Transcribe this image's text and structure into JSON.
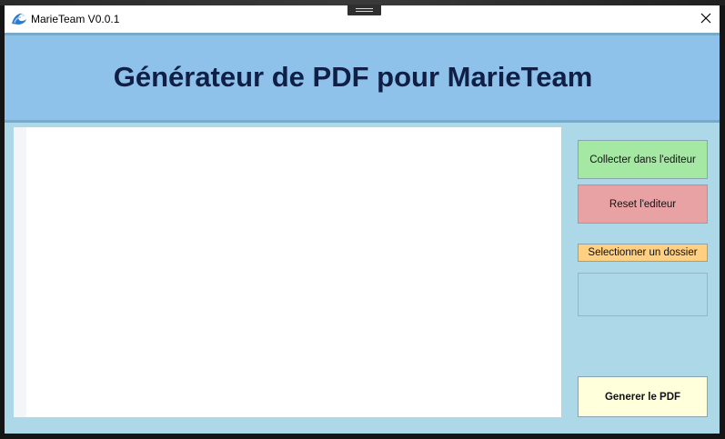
{
  "window": {
    "title": "MarieTeam V0.0.1",
    "app_icon": "wave-icon",
    "close_icon": "close-icon"
  },
  "header": {
    "title": "Générateur de PDF pour MarieTeam"
  },
  "editor": {
    "content": ""
  },
  "actions": {
    "collect_label": "Collecter dans l'editeur",
    "reset_label": "Reset l'editeur",
    "select_folder_label": "Selectionner un dossier",
    "folder_path": "",
    "generate_label": "Generer le PDF"
  },
  "colors": {
    "header_bg": "#8fc2ea",
    "body_bg": "#add8e8",
    "collect_bg": "#a5e8a4",
    "reset_bg": "#e8a2a3",
    "folder_bg": "#ffcf82",
    "generate_bg": "#ffffdc"
  }
}
